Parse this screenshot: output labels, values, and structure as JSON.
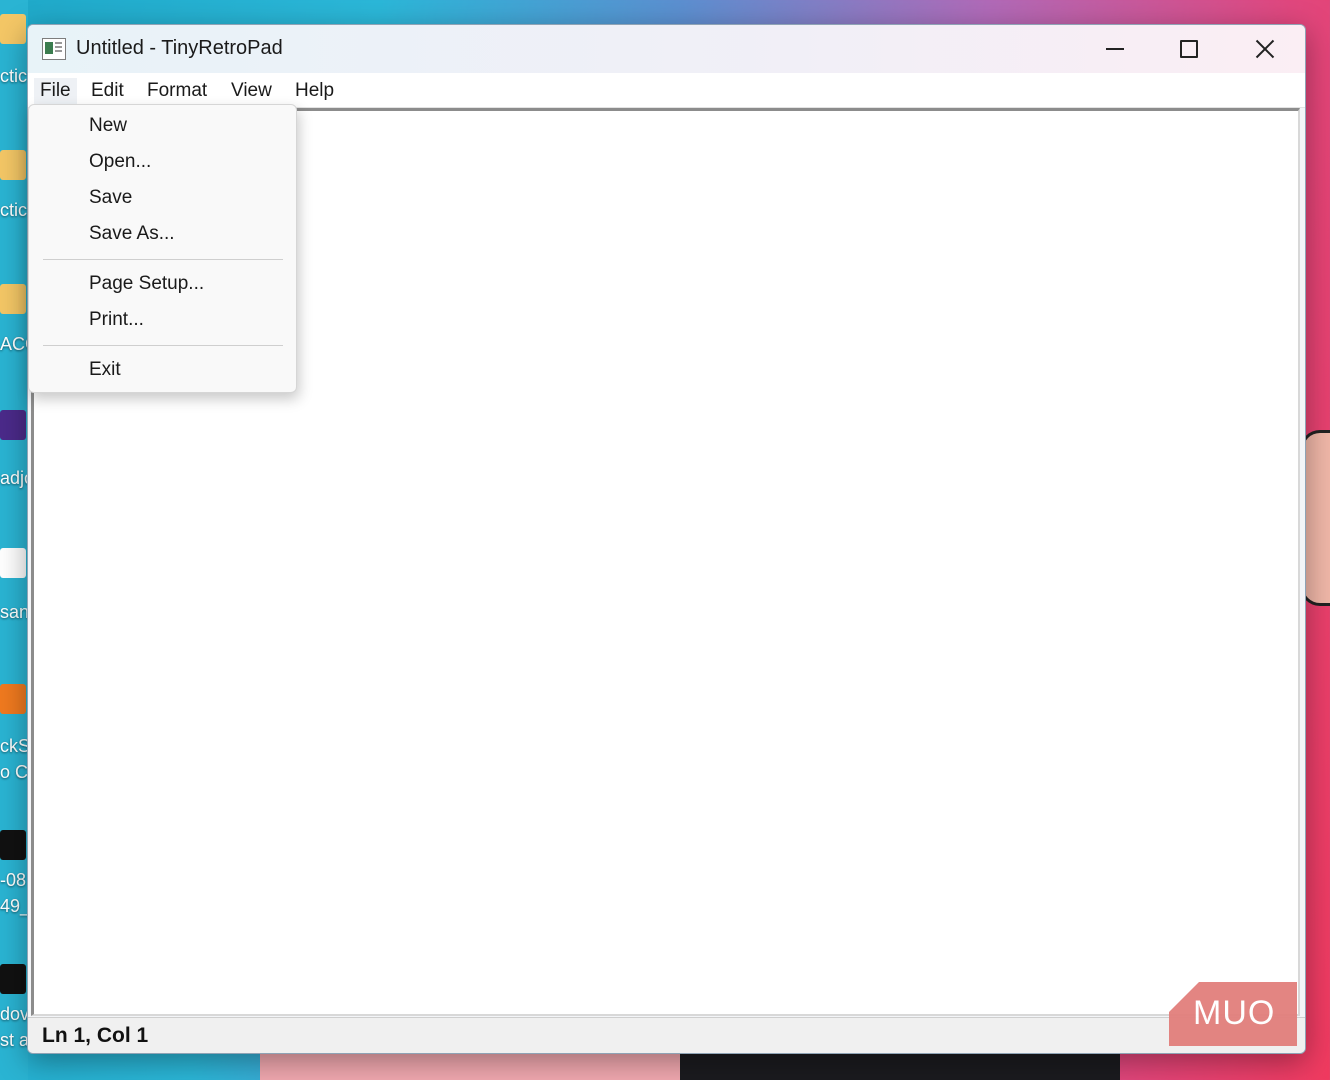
{
  "window": {
    "title": "Untitled - TinyRetroPad"
  },
  "menubar": {
    "items": [
      "File",
      "Edit",
      "Format",
      "View",
      "Help"
    ]
  },
  "file_menu": {
    "group1": [
      "New",
      "Open...",
      "Save",
      "Save As..."
    ],
    "group2": [
      "Page Setup...",
      "Print..."
    ],
    "group3": [
      "Exit"
    ]
  },
  "statusbar": {
    "position": "Ln 1, Col 1"
  },
  "desktop": {
    "labels": [
      "ctic",
      "ctic",
      "ACC",
      "adjo",
      "san",
      "ckSl",
      "o Ce",
      "-08",
      "49_",
      "dov",
      "st a"
    ]
  },
  "watermark": {
    "text": "MUO"
  },
  "colors": {
    "title_gradient_start": "#e8f3f8",
    "watermark": "#e27f7c"
  }
}
